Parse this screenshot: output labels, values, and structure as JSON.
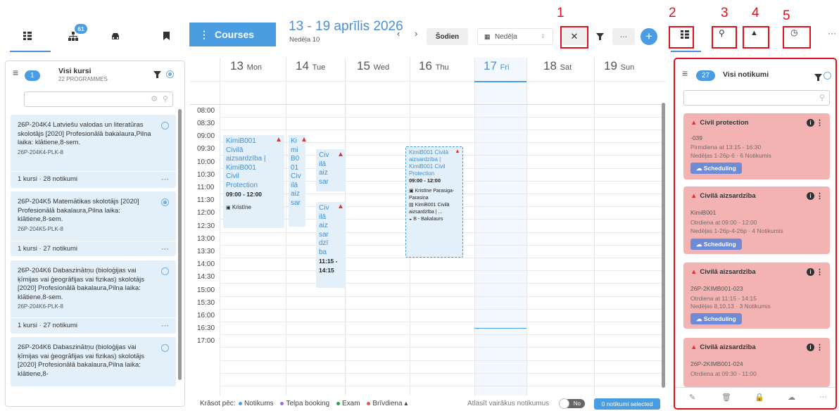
{
  "left_tabs": {
    "badge": "61"
  },
  "left_panel": {
    "count": "1",
    "title": "Visi kursi",
    "subtitle": "22 PROGRAMMES",
    "courses": [
      {
        "title": "26P-204K4 Latviešu valodas un literatūras skolotājs [2020] Profesionālā bakalaura,Pilna laika: klātiene,8-sem.",
        "code": "26P-204K4-PLK-8",
        "footer": "1 kursi · 28 notikumi",
        "selected": false
      },
      {
        "title": "26P-204K5 Matemātikas skolotājs [2020] Profesionālā bakalaura,Pilna laika: klātiene,8-sem.",
        "code": "26P-204K5-PLK-8",
        "footer": "1 kursi · 27 notikumi",
        "selected": true
      },
      {
        "title": "26P-204K6 Dabaszinātņu (bioloģijas vai ķīmijas vai ģeogrāfijas vai fizikas) skolotājs [2020] Profesionālā bakalaura,Pilna laika: klātiene,8-sem.",
        "code": "26P-204K6-PLK-8",
        "footer": "1 kursi · 27 notikumi",
        "selected": false
      },
      {
        "title": "26P-204K6 Dabaszinātņu (bioloģijas vai ķīmijas vai ģeogrāfijas vai fizikas) skolotājs [2020] Profesionālā bakalaura,Pilna laika: klātiene,8-",
        "code": "",
        "footer": "",
        "selected": false
      }
    ]
  },
  "toolbar": {
    "courses_label": "Courses",
    "date_range": "13 - 19 aprīlis 2026",
    "week": "Nedēļa 10",
    "today": "Šodien",
    "view": "Nedēļa",
    "more": "···",
    "plus": "+"
  },
  "annotations": [
    "1",
    "2",
    "3",
    "4",
    "5"
  ],
  "calendar": {
    "days": [
      {
        "num": "13",
        "name": "Mon"
      },
      {
        "num": "14",
        "name": "Tue"
      },
      {
        "num": "15",
        "name": "Wed"
      },
      {
        "num": "16",
        "name": "Thu"
      },
      {
        "num": "17",
        "name": "Fri"
      },
      {
        "num": "18",
        "name": "Sat"
      },
      {
        "num": "19",
        "name": "Sun"
      }
    ],
    "times": [
      "08:00",
      "08:30",
      "09:00",
      "09:30",
      "10:00",
      "10:30",
      "11:00",
      "11:30",
      "12:00",
      "12:30",
      "13:00",
      "13:30",
      "14:00",
      "14:30",
      "15:00",
      "15:30",
      "16:00",
      "16:30",
      "17:00"
    ],
    "events": {
      "mon": {
        "text": "KimiB001 Civilā aizsardzība | KimiB001 Civil Protection",
        "time": "09:00 - 12:00",
        "room": "Kristīne"
      },
      "tue_a": {
        "text": "Ki mi B0 01 Civ ilā aiz sar"
      },
      "tue_b": {
        "text": "Civ ilā aiz sar"
      },
      "tue_c": {
        "text": "Civ ilā aiz sar dzī ba",
        "time": "11:15 - 14:15"
      },
      "thu": {
        "text": "KimiB001 Civilā aizsardzība | KimiB001 Civil Protection",
        "time": "09:00 - 12:00",
        "person": "Kristīne Parasiga-Parasiņa",
        "course": "KimiB001 Civilā aizsardzība | ...",
        "group": "B - Bakalaurs"
      }
    }
  },
  "bottom_bar": {
    "color_by": "Krāsot pēc:",
    "legend": [
      {
        "label": "Notikums",
        "color": "#4a9de0"
      },
      {
        "label": "Telpa booking",
        "color": "#9b6fd6"
      },
      {
        "label": "Exam",
        "color": "#2e9e4f"
      },
      {
        "label": "Brīvdiena",
        "color": "#e05656"
      }
    ],
    "select_multi": "Atlasīt vairākus notikumus",
    "toggle": "No",
    "selected_count": "0 notikumi selected"
  },
  "right_panel": {
    "count": "27",
    "title": "Visi notikumi",
    "cards": [
      {
        "title": "Civil protection",
        "code": "-039",
        "when": "Pirmdiena at 13:15 - 16:30",
        "weeks": "Nedēļas 1-26p-6 · 6 Notikumis",
        "button": "Scheduling"
      },
      {
        "title": "Civilā aizsardzība",
        "code": "KimiB001",
        "when": "Otrdiena at 09:00 - 12:00",
        "weeks": "Nedēļas 1-26p-4-26p · 4 Notikumis",
        "button": "Scheduling"
      },
      {
        "title": "Civilā aizsardzība",
        "code": "26P-2KIMB001-023",
        "when": "Otrdiena at 11:15 - 14:15",
        "weeks": "Nedēļas 8,10,13 · 3 Notikumis",
        "button": "Scheduling"
      },
      {
        "title": "Civilā aizsardzība",
        "code": "26P-2KIMB001-024",
        "when": "Otrdiena at 09:30 - 11:00",
        "weeks": "",
        "button": ""
      }
    ]
  }
}
